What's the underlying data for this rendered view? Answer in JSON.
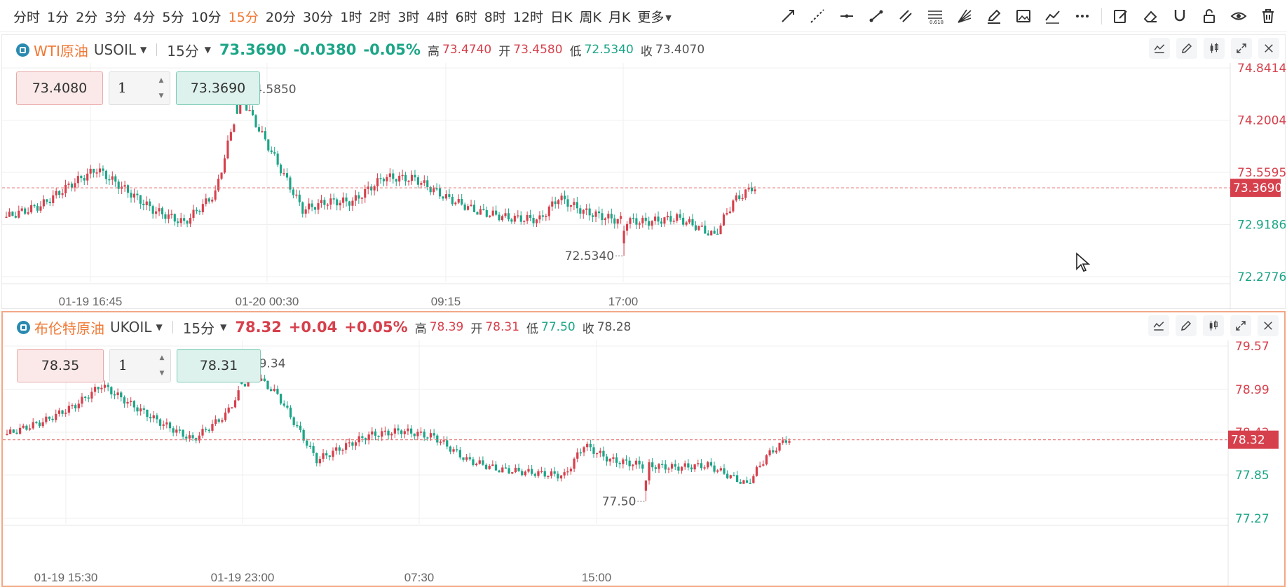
{
  "toolbar": {
    "periods": [
      "分时",
      "1分",
      "2分",
      "3分",
      "4分",
      "5分",
      "10分",
      "15分",
      "20分",
      "30分",
      "1时",
      "2时",
      "3时",
      "4时",
      "6时",
      "8时",
      "12时",
      "日K",
      "周K",
      "月K"
    ],
    "active_period": "15分",
    "more_label": "更多",
    "tools": [
      "ray-line-icon",
      "extended-line-icon",
      "horizontal-line-icon",
      "trend-line-icon",
      "parallel-channel-icon",
      "fibonacci-icon",
      "gann-fan-icon",
      "pen-icon",
      "image-icon",
      "polyline-icon",
      "more-tools-icon",
      "edit-note-icon",
      "eraser-icon",
      "magnet-icon",
      "lock-icon",
      "visibility-icon",
      "trash-icon"
    ]
  },
  "panes": [
    {
      "id": "wti",
      "name": "WTI原油",
      "code": "USOIL",
      "period": "15分",
      "last": "73.3690",
      "change": "-0.0380",
      "change_pct": "-0.05%",
      "change_dir": "down",
      "stats": {
        "high_label": "高",
        "high": "73.4740",
        "open_label": "开",
        "open": "73.4580",
        "low_label": "低",
        "low": "72.5340",
        "close_label": "收",
        "close": "73.4070"
      },
      "order": {
        "buy": "73.4080",
        "qty": "1",
        "sell": "73.3690"
      },
      "y_ticks": [
        "74.8414",
        "74.2004",
        "73.5595",
        "72.9186",
        "72.2776"
      ],
      "x_ticks": [
        "01-19 16:45",
        "01-20 00:30",
        "09:15",
        "17:00"
      ],
      "current_price_tag": "73.3690",
      "high_mark": "74.5850",
      "low_mark": "72.5340"
    },
    {
      "id": "uk",
      "name": "布伦特原油",
      "code": "UKOIL",
      "period": "15分",
      "last": "78.32",
      "change": "+0.04",
      "change_pct": "+0.05%",
      "change_dir": "up",
      "stats": {
        "high_label": "高",
        "high": "78.39",
        "open_label": "开",
        "open": "78.31",
        "low_label": "低",
        "low": "77.50",
        "close_label": "收",
        "close": "78.28"
      },
      "order": {
        "buy": "78.35",
        "qty": "1",
        "sell": "78.31"
      },
      "y_ticks": [
        "79.57",
        "78.99",
        "78.42",
        "77.85",
        "77.27"
      ],
      "x_ticks": [
        "01-19 15:30",
        "01-19 23:00",
        "07:30",
        "15:00"
      ],
      "current_price_tag": "78.32",
      "high_mark": "79.34",
      "low_mark": "77.50"
    }
  ],
  "colors": {
    "up": "#d6404c",
    "down": "#1ba587",
    "accent": "#f07834"
  }
}
